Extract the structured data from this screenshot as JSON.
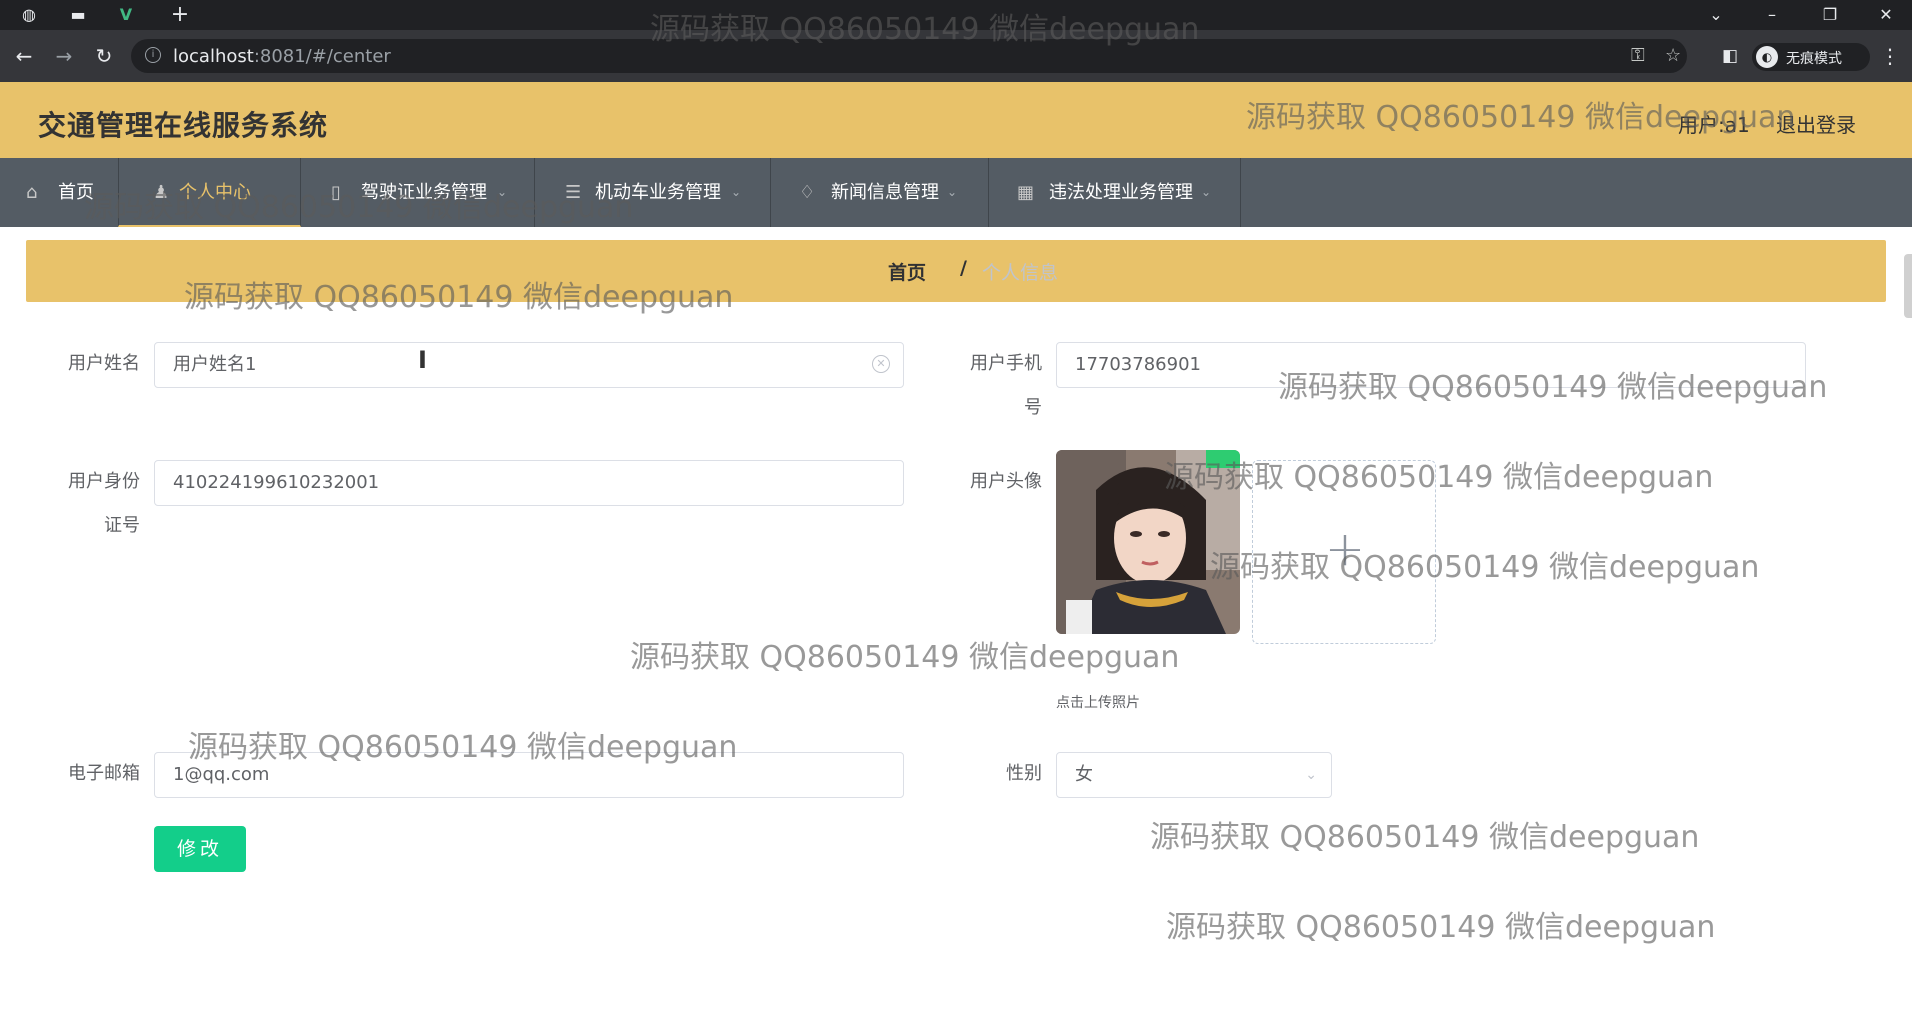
{
  "browser": {
    "url_host": "localhost",
    "url_rest": ":8081/#/center",
    "incognito_label": "无痕模式"
  },
  "header": {
    "title": "交通管理在线服务系统",
    "user_label": "用户:a1",
    "logout_label": "退出登录"
  },
  "nav": {
    "items": [
      {
        "label": "首页",
        "icon": "home-icon"
      },
      {
        "label": "个人中心",
        "icon": "user-icon"
      },
      {
        "label": "驾驶证业务管理",
        "icon": "document-icon"
      },
      {
        "label": "机动车业务管理",
        "icon": "list-icon"
      },
      {
        "label": "新闻信息管理",
        "icon": "bell-icon"
      },
      {
        "label": "违法处理业务管理",
        "icon": "grid-icon"
      }
    ]
  },
  "breadcrumb": {
    "home": "首页",
    "separator": "/",
    "current": "个人信息"
  },
  "form": {
    "name_label": "用户姓名",
    "name_value": "用户姓名1",
    "phone_label_1": "用户手机",
    "phone_label_2": "号",
    "phone_value": "17703786901",
    "idcard_label_1": "用户身份",
    "idcard_label_2": "证号",
    "idcard_value": "410224199610232001",
    "avatar_label": "用户头像",
    "upload_tip": "点击上传照片",
    "email_label": "电子邮箱",
    "email_value": "1@qq.com",
    "gender_label": "性别",
    "gender_value": "女",
    "submit_label": "修改"
  },
  "watermark": "源码获取 QQ86050149 微信deepguan",
  "colors": {
    "header_bg": "#e8c26a",
    "nav_bg": "#545c64",
    "submit_bg": "#13ce8a"
  }
}
